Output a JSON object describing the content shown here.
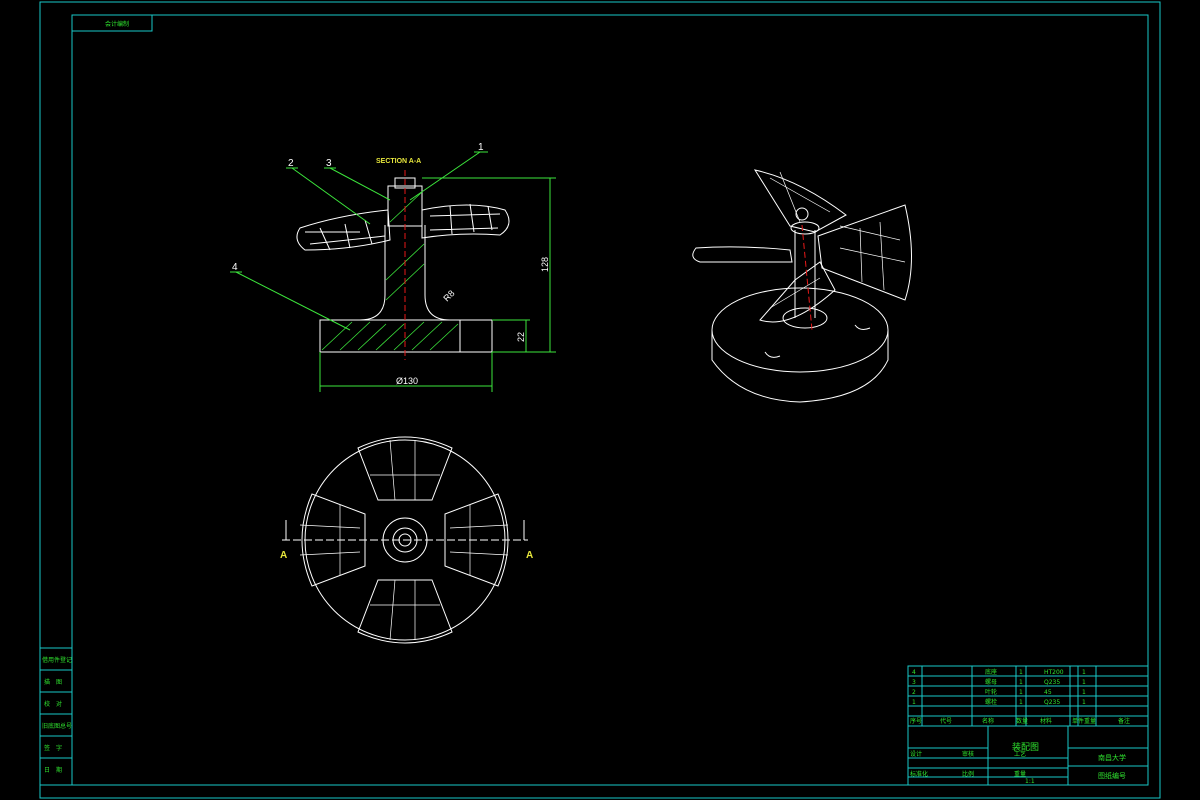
{
  "drawing": {
    "corner_label": "会计编制",
    "section_title": "SECTION A-A",
    "balloons": [
      "1",
      "2",
      "3",
      "4"
    ],
    "dimensions": {
      "overall_height": "128",
      "base_height": "22",
      "base_diameter": "Ø130",
      "fillet": "R8"
    },
    "section_marks": [
      "A",
      "A"
    ]
  },
  "left_margin_table": {
    "rows": [
      "借用件登记",
      "描　图",
      "校　对",
      "旧底图总号",
      "签　字",
      "日　期"
    ]
  },
  "title_block": {
    "bom_rows": [
      {
        "no": "4",
        "name": "底座",
        "qty": "1",
        "material": "HT200",
        "count": "1"
      },
      {
        "no": "3",
        "name": "螺母",
        "qty": "1",
        "material": "Q235",
        "count": "1"
      },
      {
        "no": "2",
        "name": "叶轮",
        "qty": "1",
        "material": "45",
        "count": "1"
      },
      {
        "no": "1",
        "name": "螺栓",
        "qty": "1",
        "material": "Q235",
        "count": "1"
      }
    ],
    "header_labels": [
      "序号",
      "代号",
      "名称",
      "数量",
      "材料",
      "单件重量",
      "备注"
    ],
    "drawing_name": "装配图",
    "school": "南昌大学",
    "drawing_number": "图纸编号",
    "sub_labels": [
      "设计",
      "审核",
      "工艺",
      "标准化",
      "比例",
      "重量"
    ],
    "scale": "1:1"
  },
  "colors": {
    "frame": "#19c8c8",
    "drawing_lines": "#ffffff",
    "leaders": "#3ce63c",
    "section_hatch": "#3ce63c",
    "centerline": "#e61919",
    "section_text": "#e6e63c"
  }
}
